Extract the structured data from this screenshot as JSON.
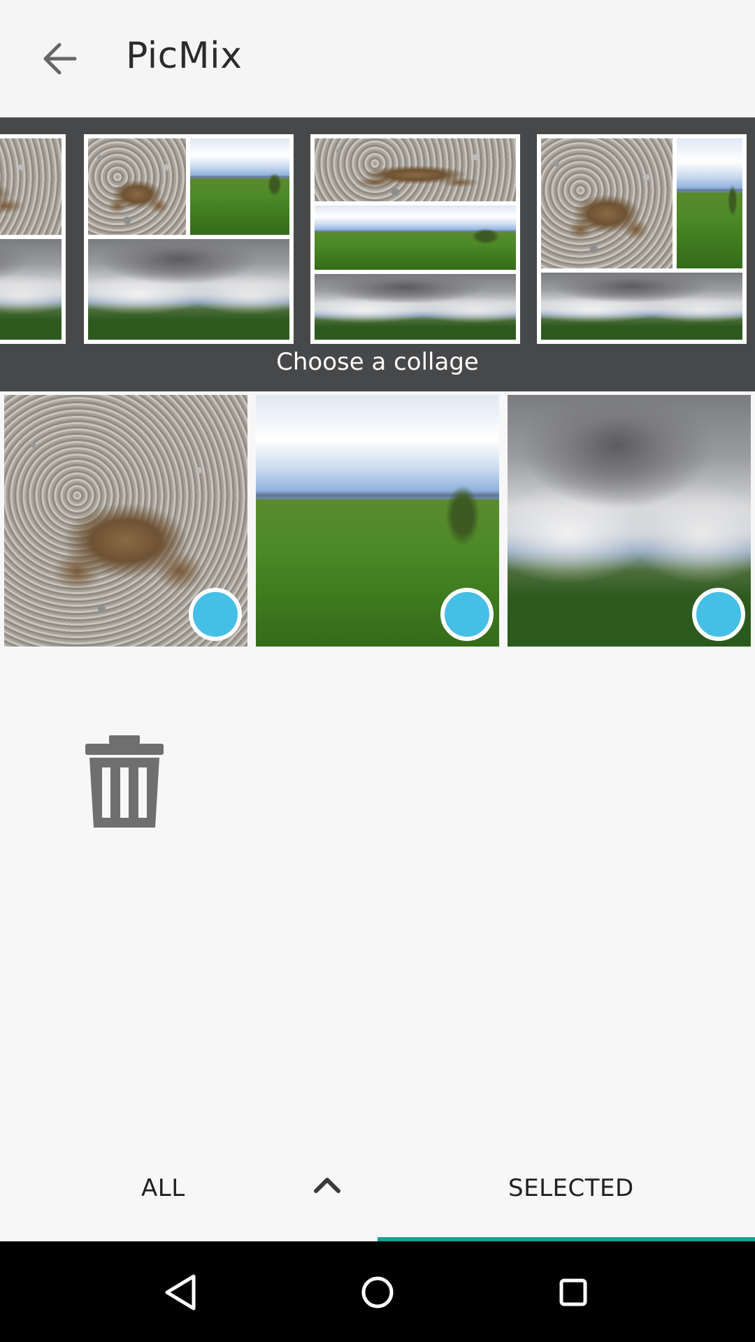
{
  "appbar": {
    "title": "PicMix",
    "back_icon": "arrow-back-icon"
  },
  "collage_strip": {
    "caption": "Choose a collage",
    "options": [
      {
        "name": "collage-option-1",
        "tiles": [
          "toad",
          "sky",
          "field"
        ]
      },
      {
        "name": "collage-option-2",
        "tiles": [
          "toad",
          "field",
          "sky"
        ]
      },
      {
        "name": "collage-option-3",
        "tiles": [
          "toad",
          "field",
          "sky"
        ]
      },
      {
        "name": "collage-option-4",
        "tiles": [
          "toad",
          "field",
          "sky"
        ]
      }
    ]
  },
  "photos": [
    {
      "subject": "toad on gravel",
      "selected": true
    },
    {
      "subject": "green field with sky",
      "selected": true
    },
    {
      "subject": "cloudy sky over field",
      "selected": true
    }
  ],
  "trash_icon": "trash-icon",
  "tabs": {
    "all_label": "ALL",
    "selected_label": "SELECTED",
    "active": "SELECTED",
    "chevron_icon": "chevron-up-icon"
  },
  "colors": {
    "accent": "#1f9e93",
    "select_dot": "#46bfe6",
    "strip_bg": "#47484a"
  },
  "system_nav": {
    "back": "nav-back-icon",
    "home": "nav-home-icon",
    "recents": "nav-recents-icon"
  }
}
